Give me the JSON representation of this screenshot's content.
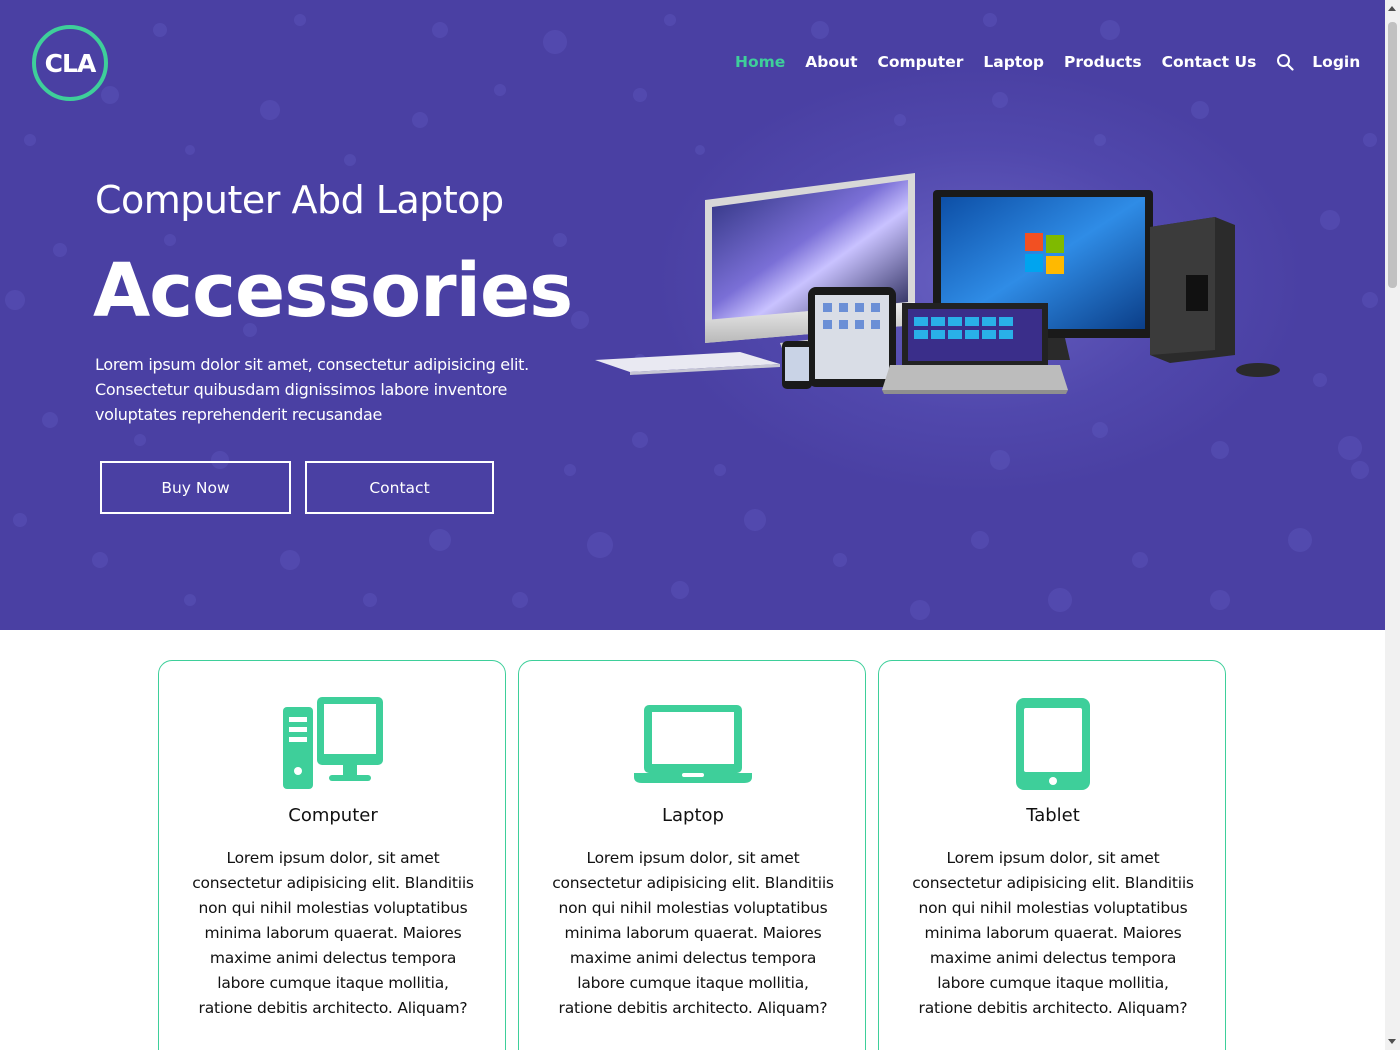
{
  "brand": {
    "logo_text": "CLA"
  },
  "nav": {
    "items": [
      {
        "label": "Home",
        "active": true
      },
      {
        "label": "About"
      },
      {
        "label": "Computer"
      },
      {
        "label": "Laptop"
      },
      {
        "label": "Products"
      },
      {
        "label": "Contact Us"
      }
    ],
    "search_icon": "search-icon",
    "login_label": "Login"
  },
  "hero": {
    "subtitle": "Computer Abd Laptop",
    "title": "Accessories",
    "text": "Lorem ipsum dolor sit amet, consectetur adipisicing elit. Consectetur quibusdam dignissimos labore inventore voluptates reprehenderit recusandae",
    "buy_label": "Buy Now",
    "contact_label": "Contact",
    "image": "computers-laptops-tablets-phones"
  },
  "cards": [
    {
      "icon": "desktop-computer-icon",
      "title": "Computer",
      "text": "Lorem ipsum dolor, sit amet consectetur adipisicing elit. Blanditiis non qui nihil molestias voluptatibus minima laborum quaerat. Maiores maxime animi delectus tempora labore cumque itaque mollitia, ratione debitis architecto. Aliquam?"
    },
    {
      "icon": "laptop-icon",
      "title": "Laptop",
      "text": "Lorem ipsum dolor, sit amet consectetur adipisicing elit. Blanditiis non qui nihil molestias voluptatibus minima laborum quaerat. Maiores maxime animi delectus tempora labore cumque itaque mollitia, ratione debitis architecto. Aliquam?"
    },
    {
      "icon": "tablet-icon",
      "title": "Tablet",
      "text": "Lorem ipsum dolor, sit amet consectetur adipisicing elit. Blanditiis non qui nihil molestias voluptatibus minima laborum quaerat. Maiores maxime animi delectus tempora labore cumque itaque mollitia, ratione debitis architecto. Aliquam?"
    }
  ],
  "colors": {
    "hero_bg": "#4a40a3",
    "accent": "#3ecf9a",
    "text_dark": "#111111",
    "white": "#ffffff"
  }
}
